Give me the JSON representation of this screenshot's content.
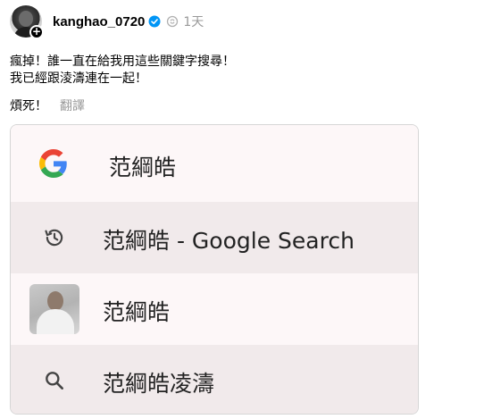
{
  "post": {
    "username": "kanghao_0720",
    "timestamp": "1天",
    "lines": [
      "瘋掉！誰一直在給我用這些關鍵字搜尋！",
      "我已經跟淩濤連在一起！"
    ],
    "followup": "煩死！",
    "translate_label": "翻譯"
  },
  "icons": {
    "verified": "verified-badge-icon",
    "repost": "repost-icon",
    "add": "add-follow-icon",
    "google": "google-logo-icon",
    "history": "history-icon",
    "search": "search-icon"
  },
  "colors": {
    "verified_blue": "#0095f6",
    "card_bg": "#fdf7f8",
    "card_row_alt": "#f1eaeb",
    "muted_text": "#999999"
  },
  "search_card": {
    "query": "范綱皓",
    "suggestions": [
      {
        "text": "范綱皓 - Google Search",
        "icon": "history-icon"
      },
      {
        "text": "范綱皓",
        "icon": "profile-thumbnail"
      },
      {
        "text": "范綱皓凌濤",
        "icon": "search-icon"
      }
    ]
  }
}
